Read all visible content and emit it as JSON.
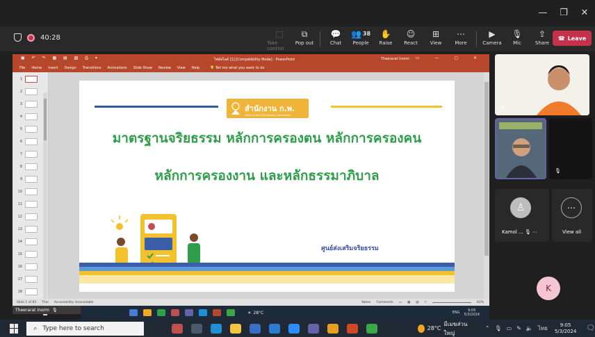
{
  "meeting": {
    "timer": "40:28",
    "toolbar": [
      {
        "label": "Take control",
        "icon": "take-control-icon",
        "glyph": "⬚",
        "dim": true
      },
      {
        "label": "Pop out",
        "icon": "pop-out-icon",
        "glyph": "⧉"
      },
      {
        "label": "Chat",
        "icon": "chat-icon",
        "glyph": "💬"
      },
      {
        "label": "People",
        "icon": "people-icon",
        "glyph": "👥",
        "count": "38"
      },
      {
        "label": "Raise",
        "icon": "raise-hand-icon",
        "glyph": "✋"
      },
      {
        "label": "React",
        "icon": "react-icon",
        "glyph": "☺"
      },
      {
        "label": "View",
        "icon": "view-icon",
        "glyph": "⊞"
      },
      {
        "label": "More",
        "icon": "more-icon",
        "glyph": "⋯"
      },
      {
        "label": "Camera",
        "icon": "camera-off-icon",
        "glyph": "▶"
      },
      {
        "label": "Mic",
        "icon": "mic-off-icon",
        "glyph": "🎙"
      },
      {
        "label": "Share",
        "icon": "share-icon",
        "glyph": "⇪"
      }
    ],
    "leave_label": "Leave",
    "leave_color": "#c4314b"
  },
  "ppt": {
    "filename": "ไฟล์สไลด์ [1] [Compatibility Mode] - PowerPoint",
    "user": "Theerarat Inorm",
    "menu": [
      "File",
      "Home",
      "Insert",
      "Design",
      "Transitions",
      "Animations",
      "Slide Show",
      "Review",
      "View",
      "Help"
    ],
    "tell_me": "Tell me what you want to do",
    "thumb_numbers": [
      "1",
      "2",
      "3",
      "4",
      "5",
      "6",
      "7",
      "8",
      "9",
      "10",
      "11",
      "12",
      "13",
      "14",
      "15",
      "16",
      "17",
      "18"
    ],
    "status_left": "Slide 1 of 83",
    "status_lang": "Thai",
    "status_access": "Accessibility: Unavailable",
    "notes": "Notes",
    "comments": "Comments",
    "zoom": "83%",
    "accent": "#b7472a"
  },
  "slide": {
    "logo_text": "สำนักงาน ก.พ.",
    "logo_sub": "Office of the Civil Service Commission",
    "title_line1": "มาตรฐานจริยธรรม หลักการครองตน หลักการครองคน",
    "title_line2": "หลักการครองงาน และหลักธรรมาภิบาล",
    "center_name": "ศูนย์ส่งเสริมจริยธรรม",
    "title_color": "#2f9e4a"
  },
  "presenter_label": "Theerarat Inorm",
  "inner_taskbar": {
    "weather": "28°C",
    "lang": "ENG",
    "time": "9:05",
    "date": "5/3/2024"
  },
  "participants": {
    "tile4_name": "Kamol ...",
    "view_all": "View all",
    "k_initial": "K"
  },
  "taskbar": {
    "search_placeholder": "Type here to search",
    "weather": "28°C",
    "weather_desc": "มีเมฆส่วนใหญ่",
    "lang": "ไทย",
    "time": "9:05",
    "date": "5/3/2024"
  }
}
